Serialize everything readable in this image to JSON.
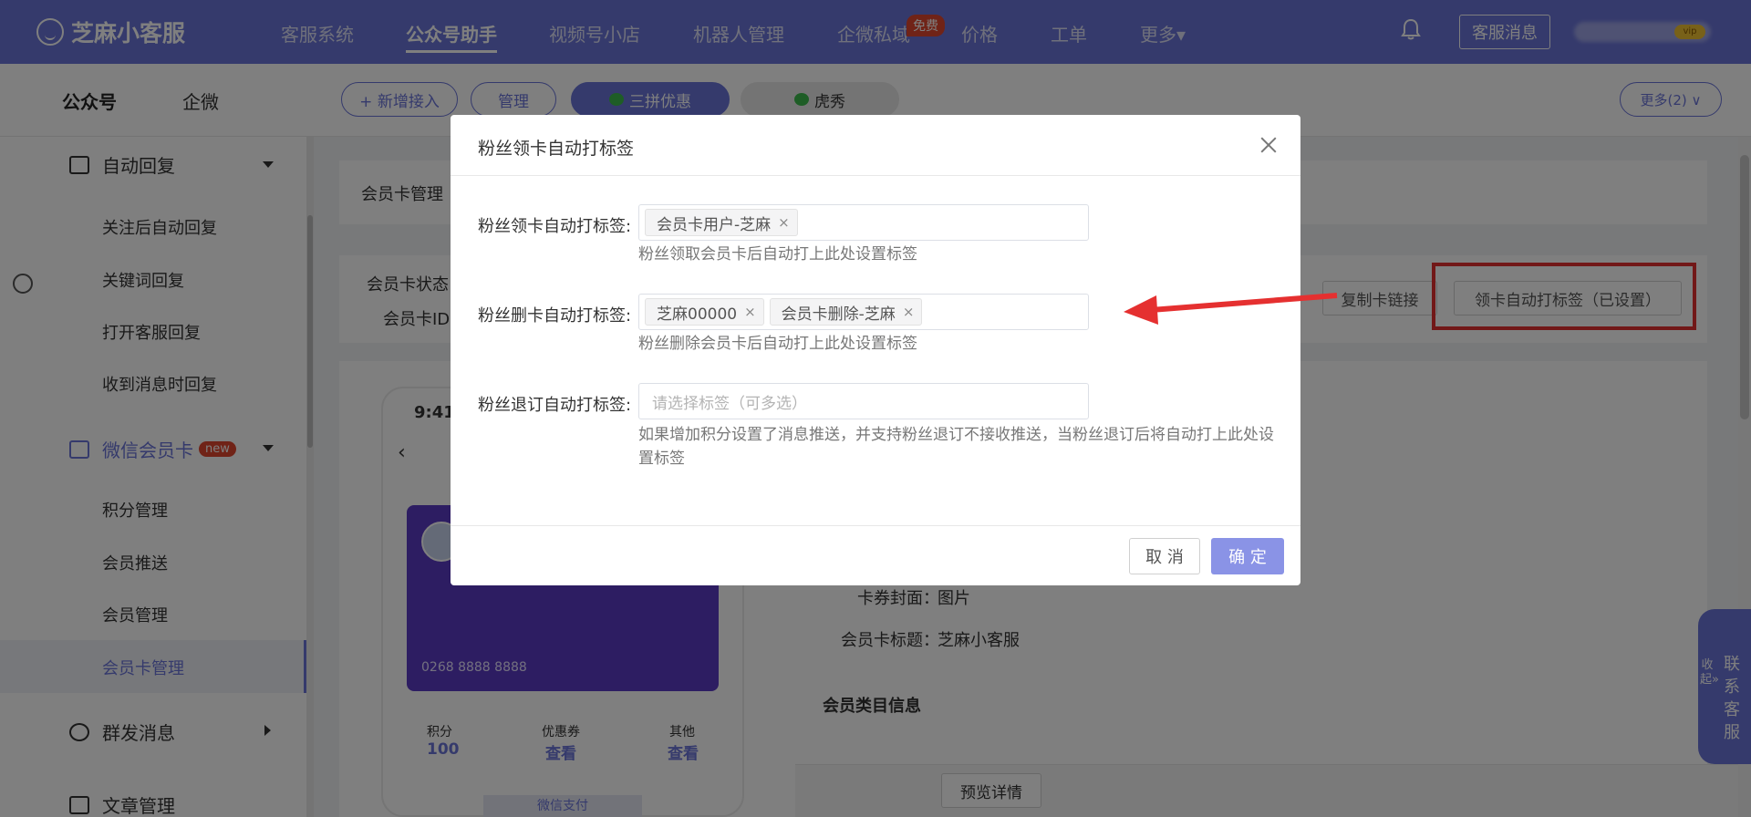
{
  "topbar": {
    "logo": "芝麻小客服",
    "nav": [
      "客服系统",
      "公众号助手",
      "视频号小店",
      "机器人管理",
      "企微私域",
      "价格",
      "工单",
      "更多▾"
    ],
    "free_badge": "免费",
    "cs_message_btn": "客服消息",
    "vip": "vip"
  },
  "subbar": {
    "tabs": [
      "公众号",
      "企微"
    ],
    "add_btn": "+ 新增接入",
    "manage_btn": "管理",
    "account_1": "三拼优惠",
    "account_2": "虎秀",
    "more_btn": "更多(2) ∨"
  },
  "sidebar": {
    "auto_reply": "自动回复",
    "auto_reply_items": [
      "关注后自动回复",
      "关键词回复",
      "打开客服回复",
      "收到消息时回复"
    ],
    "member_card": "微信会员卡",
    "new_badge": "new",
    "member_card_items": [
      "积分管理",
      "会员推送",
      "会员管理",
      "会员卡管理"
    ],
    "mass_msg": "群发消息",
    "article": "文章管理"
  },
  "content": {
    "section_title": "会员卡管理",
    "status_label": "会员卡状态：",
    "id_label": "会员卡ID：",
    "copy_link_btn": "复制卡链接",
    "auto_tag_btn": "领卡自动打标签（已设置）",
    "phone_time": "9:41",
    "card_number": "0268 8888 8888",
    "stat_points_label": "积分",
    "stat_points_value": "100",
    "stat_coupon_label": "优惠券",
    "stat_coupon_value": "查看",
    "stat_other_label": "其他",
    "stat_other_value": "查看",
    "wx_pay": "微信支付",
    "cover_label": "卡券封面：",
    "cover_value": "图片",
    "title_label": "会员卡标题：",
    "title_value": "芝麻小客服",
    "category_heading": "会员类目信息",
    "preview_btn": "预览详情"
  },
  "float_service": {
    "collapse": "收起»",
    "text": "联系客服"
  },
  "modal": {
    "title": "粉丝领卡自动打标签",
    "row1_label": "粉丝领卡自动打标签:",
    "row1_tags": [
      "会员卡用户-芝麻"
    ],
    "row1_hint": "粉丝领取会员卡后自动打上此处设置标签",
    "row2_label": "粉丝删卡自动打标签:",
    "row2_tags": [
      "芝麻00000",
      "会员卡删除-芝麻"
    ],
    "row2_hint": "粉丝删除会员卡后自动打上此处设置标签",
    "row3_label": "粉丝退订自动打标签:",
    "row3_placeholder": "请选择标签（可多选）",
    "row3_hint": "如果增加积分设置了消息推送，并支持粉丝退订不接收推送，当粉丝退订后将自动打上此处设置标签",
    "cancel": "取 消",
    "confirm": "确 定"
  },
  "colors": {
    "brand": "#6a74d9",
    "annotation": "#e53030"
  }
}
